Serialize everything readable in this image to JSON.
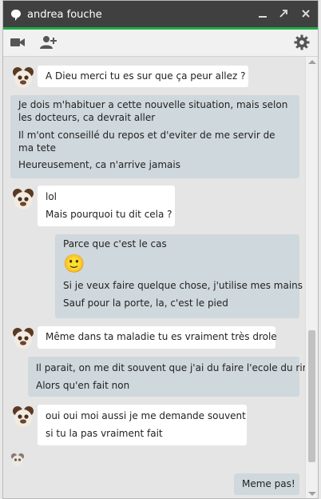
{
  "window": {
    "title": "andrea fouche"
  },
  "title_buttons": [
    "minimize-icon",
    "popout-icon",
    "close-icon"
  ],
  "toolbar": {
    "icons": [
      "video-call-icon",
      "add-person-icon",
      "settings-icon"
    ]
  },
  "colors": {
    "titlebar": "#404040",
    "accent": "#1fad45",
    "incoming": "#ffffff",
    "outgoing": "#cfd8dc"
  },
  "messages": [
    {
      "from": "contact",
      "lines": [
        "A Dieu merci tu es sur que ça peur allez ?"
      ]
    },
    {
      "from": "me",
      "lines": [
        "Je dois m'habituer a cette nouvelle situation, mais selon les docteurs, ca devrait aller",
        "Il m'ont conseillé du repos et d'eviter de me servir de ma tete",
        "Heureusement, ca n'arrive jamais"
      ]
    },
    {
      "from": "contact",
      "lines": [
        "lol",
        "Mais pourquoi tu dit cela ?"
      ]
    },
    {
      "from": "me",
      "lines": [
        "Parce que c'est le cas",
        "🙂",
        "Si je veux faire quelque chose, j'utilise mes mains",
        "Sauf pour la porte, la, c'est le pied"
      ]
    },
    {
      "from": "contact",
      "lines": [
        "Même dans ta maladie tu es vraiment très drole"
      ]
    },
    {
      "from": "me",
      "lines": [
        "Il parait, on me dit souvent que j'ai du faire l'ecole du rire",
        "Alors qu'en fait non"
      ]
    },
    {
      "from": "contact",
      "lines": [
        "oui oui moi aussi je me demande souvent",
        "si tu la pas vraiment fait"
      ]
    },
    {
      "from": "me",
      "lines": [
        "Meme pas!"
      ]
    }
  ]
}
